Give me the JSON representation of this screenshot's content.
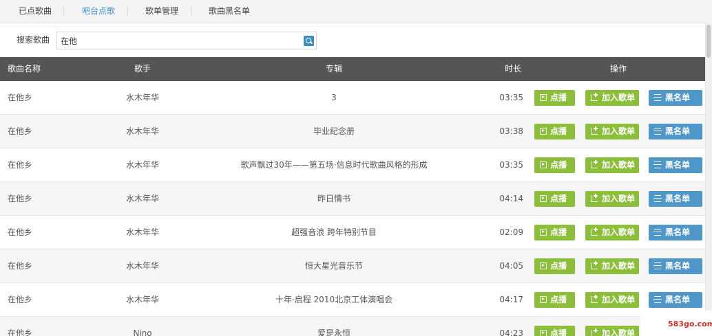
{
  "tabs": [
    {
      "label": "已点歌曲",
      "active": false
    },
    {
      "label": "吧台点歌",
      "active": true
    },
    {
      "label": "歌单管理",
      "active": false
    },
    {
      "label": "歌曲黑名单",
      "active": false
    }
  ],
  "search": {
    "label": "搜索歌曲",
    "value": "在他",
    "icon": "search-icon"
  },
  "table": {
    "headers": {
      "name": "歌曲名称",
      "artist": "歌手",
      "album": "专辑",
      "duration": "时长",
      "actions": "操作"
    },
    "rows": [
      {
        "name": "在他乡",
        "artist": "水木年华",
        "album": "3",
        "duration": "03:35"
      },
      {
        "name": "在他乡",
        "artist": "水木年华",
        "album": "毕业纪念册",
        "duration": "03:38"
      },
      {
        "name": "在他乡",
        "artist": "水木年华",
        "album": "歌声飘过30年——第五场·信息时代歌曲风格的形成",
        "duration": "03:35"
      },
      {
        "name": "在他乡",
        "artist": "水木年华",
        "album": "昨日情书",
        "duration": "04:14"
      },
      {
        "name": "在他乡",
        "artist": "水木年华",
        "album": "超强音浪 跨年特别节目",
        "duration": "02:09"
      },
      {
        "name": "在他乡",
        "artist": "水木年华",
        "album": "恒大星光音乐节",
        "duration": "04:05"
      },
      {
        "name": "在他乡",
        "artist": "水木年华",
        "album": "十年·启程 2010北京工体演唱会",
        "duration": "04:17"
      },
      {
        "name": "在他乡",
        "artist": "Nino",
        "album": "爱是永恒",
        "duration": "04:23"
      }
    ]
  },
  "actions": {
    "play": "点播",
    "add": "加入歌单",
    "blacklist": "黑名单"
  },
  "watermark": "583go.com",
  "colors": {
    "accent_tab": "#3a8fd0",
    "header_bg": "#555555",
    "green_button": "#8bbf3a",
    "blue_button": "#4f97c9"
  }
}
